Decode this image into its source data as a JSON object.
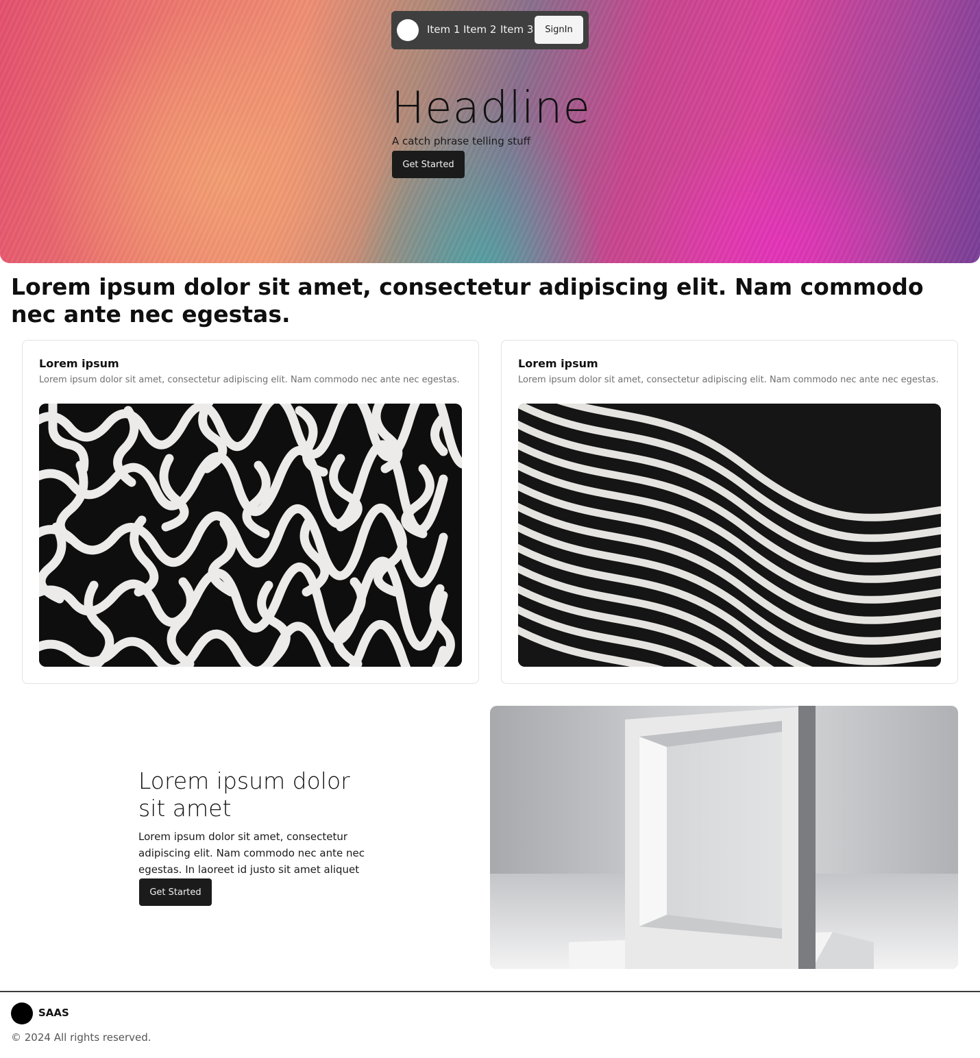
{
  "nav": {
    "items": [
      "Item 1",
      "Item 2",
      "Item 3"
    ],
    "signin_label": "SignIn"
  },
  "hero": {
    "headline": "Headline",
    "catch_phrase": "A catch phrase telling stuff",
    "cta_label": "Get Started"
  },
  "section": {
    "heading": "Lorem ipsum dolor sit amet, consectetur adipiscing elit. Nam commodo nec ante nec egestas."
  },
  "cards": [
    {
      "title": "Lorem ipsum",
      "description": "Lorem ipsum dolor sit amet, consectetur adipiscing elit. Nam commodo nec ante nec egestas."
    },
    {
      "title": "Lorem ipsum",
      "description": "Lorem ipsum dolor sit amet, consectetur adipiscing elit. Nam commodo nec ante nec egestas."
    }
  ],
  "feature": {
    "title": "Lorem ipsum dolor sit amet",
    "text": "Lorem ipsum dolor sit amet, consectetur adipiscing elit. Nam commodo nec ante nec egestas. In laoreet id justo sit amet aliquet",
    "cta_label": "Get Started"
  },
  "footer": {
    "brand": "SAAS",
    "copyright": "© 2024 All rights reserved."
  },
  "colors": {
    "dark_button": "#1b1b1b",
    "nav_background": "#3f3f3f",
    "muted_text": "#6f6f6f"
  }
}
